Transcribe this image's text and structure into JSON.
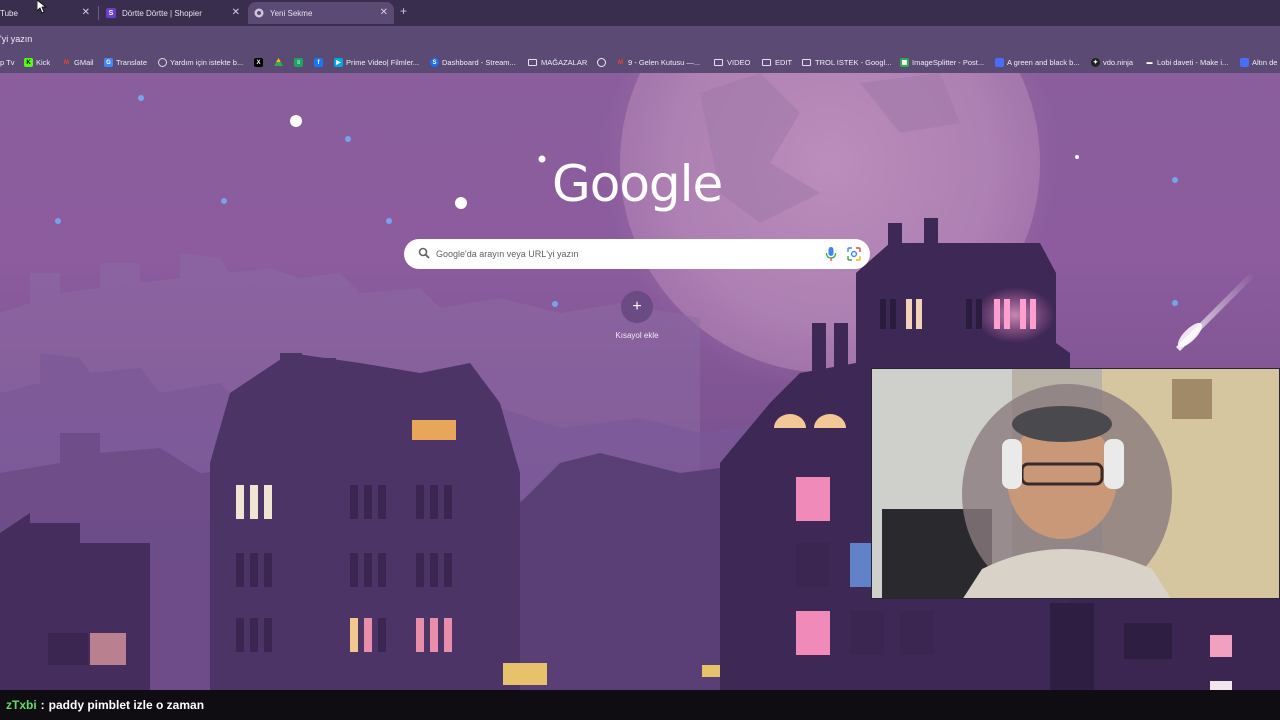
{
  "tabs": [
    {
      "label": "Tube",
      "favicon": "youtube-icon",
      "active": false
    },
    {
      "label": "Dörtte Dörtte | Shopier",
      "favicon": "shopier-icon",
      "active": false
    },
    {
      "label": "Yeni Sekme",
      "favicon": "chrome-icon",
      "active": true
    }
  ],
  "omnibox": {
    "text": "'yi yazın"
  },
  "bookmarks": [
    {
      "label": "p Tv",
      "icon": "tv-icon"
    },
    {
      "label": "Kick",
      "icon": "kick-icon"
    },
    {
      "label": "GMail",
      "icon": "gmail-icon"
    },
    {
      "label": "Translate",
      "icon": "translate-icon"
    },
    {
      "label": "Yardım için istekte b...",
      "icon": "help-icon"
    },
    {
      "label": "",
      "icon": "x-icon"
    },
    {
      "label": "",
      "icon": "drive-icon"
    },
    {
      "label": "",
      "icon": "sheets-icon"
    },
    {
      "label": "",
      "icon": "facebook-icon"
    },
    {
      "label": "Prime Video| Filmler...",
      "icon": "prime-video-icon"
    },
    {
      "label": "Dashboard - Stream...",
      "icon": "streamelements-icon"
    },
    {
      "label": "MAĞAZALAR",
      "icon": "folder-icon"
    },
    {
      "label": "",
      "icon": "globe-icon"
    },
    {
      "label": "9 - Gelen Kutusu —...",
      "icon": "gmail-icon"
    },
    {
      "label": "VIDEO",
      "icon": "folder-icon"
    },
    {
      "label": "EDIT",
      "icon": "folder-icon"
    },
    {
      "label": "TROL ISTEK - Googl...",
      "icon": "folder-icon"
    },
    {
      "label": "ImageSplitter - Post...",
      "icon": "imagesplitter-icon"
    },
    {
      "label": "A green and black b...",
      "icon": "document-icon"
    },
    {
      "label": "vdo.ninja",
      "icon": "vdo-ninja-icon"
    },
    {
      "label": "Lobi daveti - Make i...",
      "icon": "lobby-icon"
    },
    {
      "label": "Altın de",
      "icon": "document-icon"
    }
  ],
  "ntp": {
    "logo": "Google",
    "search_placeholder": "Google'da arayın veya URL'yi yazın",
    "shortcut_label": "Kısayol ekle"
  },
  "chat": {
    "user": "zTxbi",
    "separator": ":",
    "message": "paddy pimblet izle o zaman"
  },
  "colors": {
    "accent": "#5a4a74",
    "chat_user": "#5fdc6a",
    "sky_top": "#8a5e9c"
  }
}
